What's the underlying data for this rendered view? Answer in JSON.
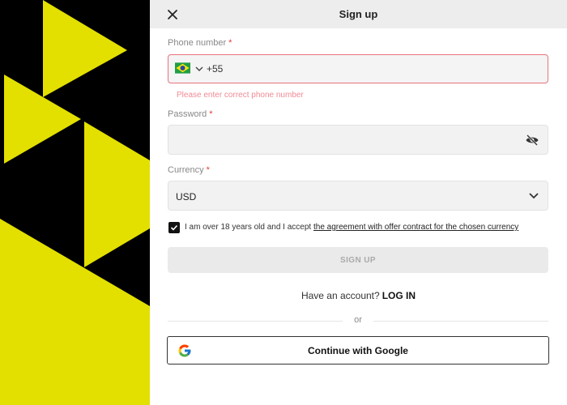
{
  "colors": {
    "accent_yellow": "#e3e000",
    "background_dark": "#000000",
    "error": "#e53935",
    "header_bg": "#ededed"
  },
  "header": {
    "title": "Sign up",
    "close_icon": "close-icon"
  },
  "phone": {
    "label": "Phone number",
    "required_mark": "*",
    "country_flag": "brazil-flag-icon",
    "code": "+55",
    "error": "Please enter correct phone number"
  },
  "password": {
    "label": "Password",
    "required_mark": "*",
    "value": "",
    "visibility_icon": "eye-off-icon"
  },
  "currency": {
    "label": "Currency",
    "required_mark": "*",
    "selected": "USD",
    "dropdown_icon": "chevron-down-icon"
  },
  "agreement": {
    "checked": true,
    "text": "I am over 18 years old and I accept",
    "link": "the agreement with offer contract for the chosen currency"
  },
  "signup_button": "SIGN UP",
  "login": {
    "prompt": "Have an account?",
    "link": "LOG IN"
  },
  "divider": "or",
  "google_button": {
    "label": "Continue with Google",
    "icon": "google-icon"
  }
}
